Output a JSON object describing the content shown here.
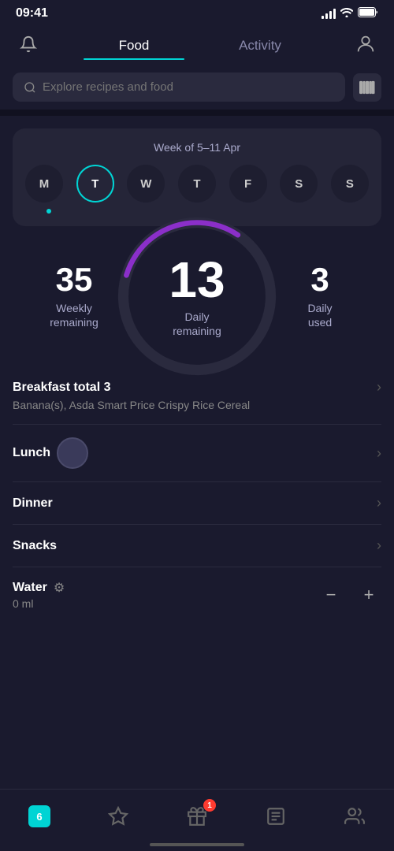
{
  "statusBar": {
    "time": "09:41"
  },
  "tabs": {
    "food": "Food",
    "activity": "Activity",
    "activeTab": "food"
  },
  "search": {
    "placeholder": "Explore recipes and food"
  },
  "weekCard": {
    "title": "Week of 5–11 Apr",
    "days": [
      "M",
      "T",
      "W",
      "T",
      "F",
      "S",
      "S"
    ],
    "activeDay": 1,
    "dotDay": 0
  },
  "stats": {
    "weekly": {
      "value": "35",
      "label": "Weekly\nremaining"
    },
    "daily": {
      "value": "13",
      "label": "Daily\nremaining"
    },
    "dailyUsed": {
      "value": "3",
      "label": "Daily\nused"
    }
  },
  "meals": {
    "breakfast": {
      "title": "Breakfast total 3",
      "subtitle": "Banana(s), Asda Smart Price Crispy Rice Cereal"
    },
    "lunch": {
      "title": "Lunch"
    },
    "dinner": {
      "title": "Dinner"
    },
    "snacks": {
      "title": "Snacks"
    }
  },
  "water": {
    "title": "Water",
    "amount": "0 ml"
  },
  "bottomNav": {
    "calendar": "6",
    "badge": "1",
    "items": [
      "calendar",
      "star",
      "gift",
      "receipt",
      "group"
    ]
  }
}
